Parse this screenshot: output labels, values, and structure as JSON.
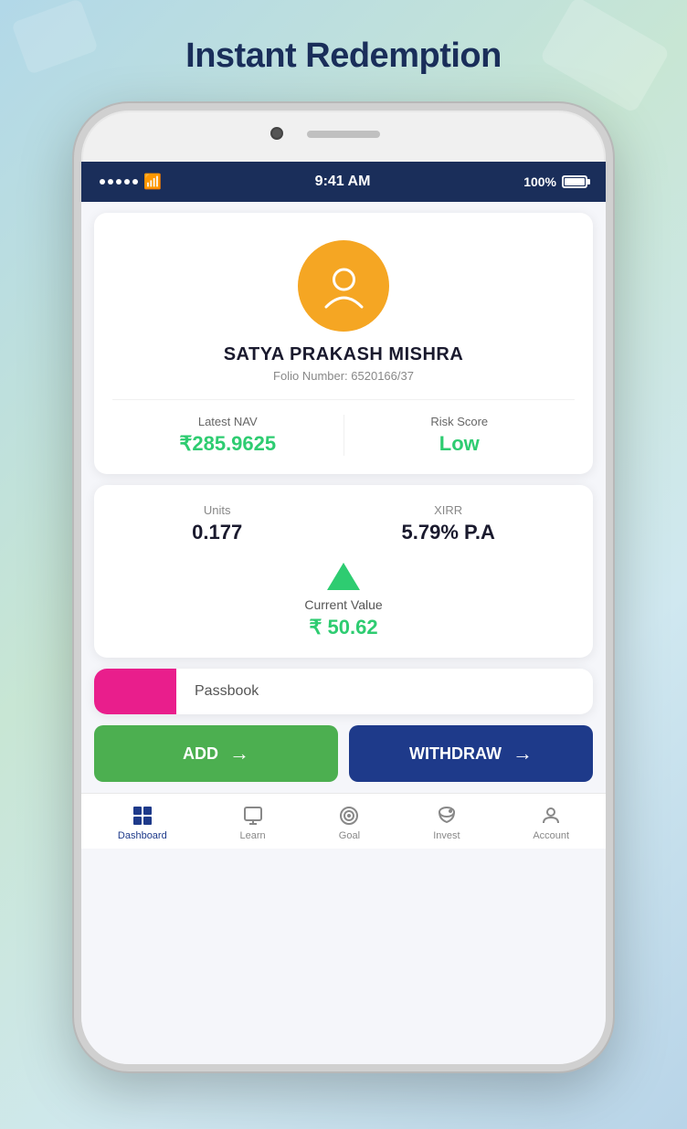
{
  "page": {
    "title": "Instant Redemption",
    "background_desc": "gradient blue-green"
  },
  "status_bar": {
    "time": "9:41 AM",
    "battery": "100%",
    "signal_dots": 5
  },
  "profile": {
    "name": "SATYA PRAKASH MISHRA",
    "folio_label": "Folio Number: 6520166/37",
    "latest_nav_label": "Latest NAV",
    "latest_nav_value": "₹285.9625",
    "risk_score_label": "Risk Score",
    "risk_score_value": "Low"
  },
  "metrics": {
    "units_label": "Units",
    "units_value": "0.177",
    "xirr_label": "XIRR",
    "xirr_value": "5.79% P.A",
    "current_value_label": "Current Value",
    "current_value": "₹ 50.62"
  },
  "passbook": {
    "label": "Passbook"
  },
  "buttons": {
    "add_label": "ADD",
    "add_arrow": "→",
    "withdraw_label": "WITHDRAW",
    "withdraw_arrow": "→"
  },
  "bottom_nav": {
    "items": [
      {
        "id": "dashboard",
        "label": "Dashboard",
        "icon": "⊞",
        "active": true
      },
      {
        "id": "learn",
        "label": "Learn",
        "icon": "□",
        "active": false
      },
      {
        "id": "goal",
        "label": "Goal",
        "icon": "◎",
        "active": false
      },
      {
        "id": "invest",
        "label": "Invest",
        "icon": "🐷",
        "active": false
      },
      {
        "id": "account",
        "label": "Account",
        "icon": "👤",
        "active": false
      }
    ]
  }
}
